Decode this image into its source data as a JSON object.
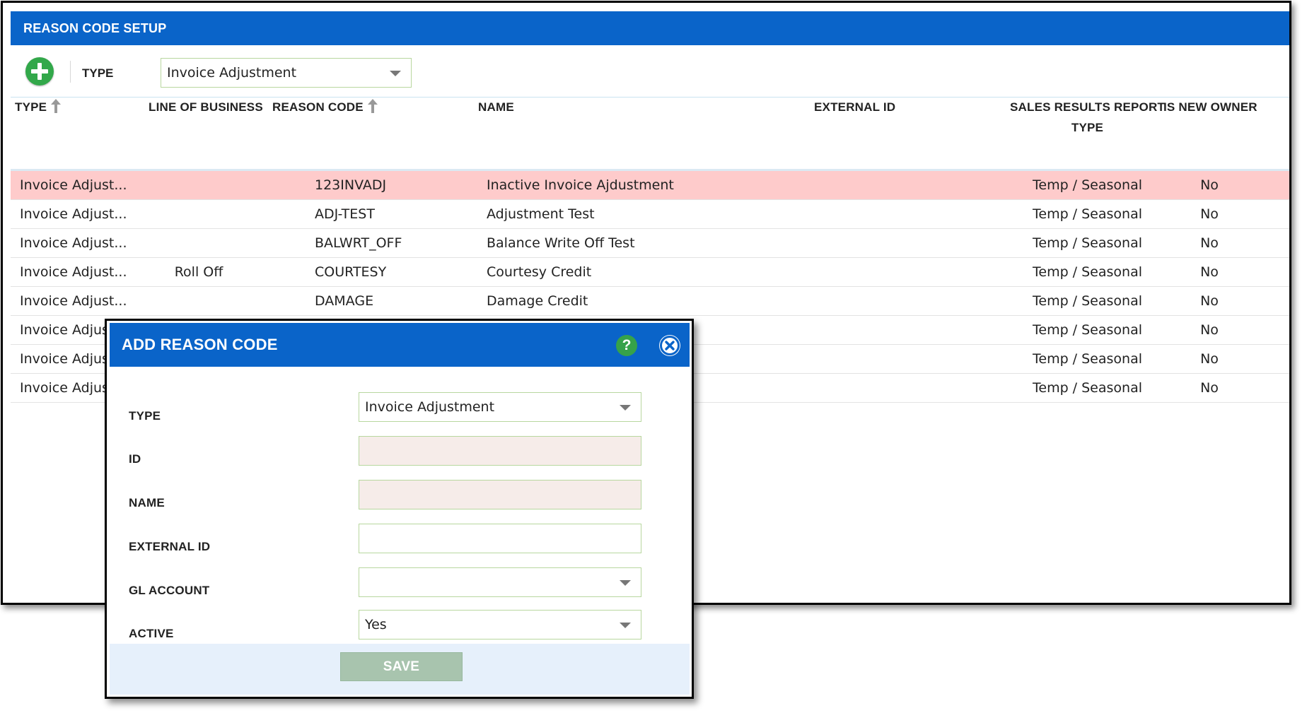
{
  "main": {
    "title": "REASON CODE SETUP",
    "filter": {
      "label": "TYPE",
      "value": "Invoice Adjustment"
    },
    "columns": {
      "type": "TYPE",
      "line_of_business": "LINE OF BUSINESS",
      "reason_code": "REASON CODE",
      "name": "NAME",
      "external_id": "EXTERNAL ID",
      "sales_results_report_type_1": "SALES RESULTS REPORT",
      "sales_results_report_type_2": "TYPE",
      "is_new_owner": "IS NEW OWNER"
    },
    "rows": [
      {
        "type": "Invoice Adjust...",
        "line_of_business": "",
        "reason_code": "123INVADJ",
        "name": "Inactive Invoice Ajdustment",
        "external_id": "",
        "sales_results_report_type": "Temp / Seasonal",
        "is_new_owner": "No"
      },
      {
        "type": "Invoice Adjust...",
        "line_of_business": "",
        "reason_code": "ADJ-TEST",
        "name": "Adjustment Test",
        "external_id": "",
        "sales_results_report_type": "Temp / Seasonal",
        "is_new_owner": "No"
      },
      {
        "type": "Invoice Adjust...",
        "line_of_business": "",
        "reason_code": "BALWRT_OFF",
        "name": "Balance Write Off Test",
        "external_id": "",
        "sales_results_report_type": "Temp / Seasonal",
        "is_new_owner": "No"
      },
      {
        "type": "Invoice Adjust...",
        "line_of_business": "Roll Off",
        "reason_code": "COURTESY",
        "name": "Courtesy Credit",
        "external_id": "",
        "sales_results_report_type": "Temp / Seasonal",
        "is_new_owner": "No"
      },
      {
        "type": "Invoice Adjust...",
        "line_of_business": "",
        "reason_code": "DAMAGE",
        "name": "Damage Credit",
        "external_id": "",
        "sales_results_report_type": "Temp / Seasonal",
        "is_new_owner": "No"
      },
      {
        "type": "Invoice Adjus",
        "line_of_business": "",
        "reason_code": "",
        "name": "",
        "external_id": "",
        "sales_results_report_type": "Temp / Seasonal",
        "is_new_owner": "No"
      },
      {
        "type": "Invoice Adjus",
        "line_of_business": "",
        "reason_code": "",
        "name": "",
        "external_id": "",
        "sales_results_report_type": "Temp / Seasonal",
        "is_new_owner": "No"
      },
      {
        "type": "Invoice Adjus",
        "line_of_business": "",
        "reason_code": "",
        "name": "",
        "external_id": "",
        "sales_results_report_type": "Temp / Seasonal",
        "is_new_owner": "No"
      }
    ]
  },
  "modal": {
    "title": "ADD REASON CODE",
    "help_label": "?",
    "fields": {
      "type": {
        "label": "TYPE",
        "value": "Invoice Adjustment"
      },
      "id": {
        "label": "ID",
        "value": ""
      },
      "name": {
        "label": "NAME",
        "value": ""
      },
      "external_id": {
        "label": "EXTERNAL ID",
        "value": ""
      },
      "gl_account": {
        "label": "GL ACCOUNT",
        "value": ""
      },
      "active": {
        "label": "ACTIVE",
        "value": "Yes"
      }
    },
    "save_label": "SAVE"
  },
  "icons": {
    "add": "plus-circle-icon",
    "sort": "arrow-up-icon",
    "help": "question-circle-icon",
    "close": "close-circle-icon",
    "dropdown": "chevron-down-icon"
  },
  "colors": {
    "header_blue": "#0a64c9",
    "add_green": "#32a84a",
    "row_highlight": "#fecbcb",
    "required_field": "#f6ece9",
    "save_disabled": "#a8c4ae"
  }
}
